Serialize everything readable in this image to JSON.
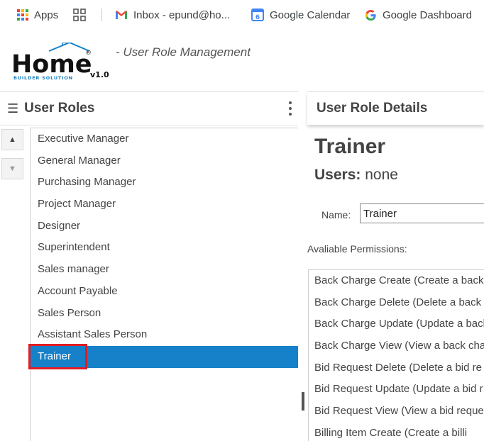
{
  "bookmarks": [
    {
      "label": "Apps",
      "icon": "apps-grid-icon"
    },
    {
      "label": "",
      "icon": "tab-groups-icon"
    },
    {
      "label": "Inbox - epund@ho...",
      "icon": "gmail-icon"
    },
    {
      "label": "Google Calendar",
      "icon": "google-calendar-icon"
    },
    {
      "label": "Google Dashboard",
      "icon": "google-g-icon"
    }
  ],
  "header": {
    "logo_main": "Home",
    "logo_sub": "BUILDER SOLUTION",
    "logo_version": "v1.0",
    "logo_reg": "®",
    "subtitle": "- User Role Management"
  },
  "left_panel": {
    "title": "User Roles",
    "roles": [
      "Executive Manager",
      "General Manager",
      "Purchasing Manager",
      "Project Manager",
      "Designer",
      "Superintendent",
      "Sales manager",
      "Account Payable",
      "Sales Person",
      "Assistant Sales Person",
      "Trainer"
    ],
    "selected_index": 10
  },
  "right_panel": {
    "title": "User Role Details",
    "role_name": "Trainer",
    "users_label": "Users:",
    "users_value": "none",
    "name_label": "Name:",
    "name_value": "Trainer",
    "permissions_label": "Avaliable Permissions:",
    "permissions": [
      "Back Charge Create (Create a back c",
      "Back Charge Delete (Delete a back s",
      "Back Charge Update (Update a back",
      "Back Charge View (View a back char",
      "Bid Request Delete (Delete a bid re",
      "Bid Request Update (Update a bid r",
      "Bid Request View (View a bid reque",
      "Billing Item Create (Create a billi"
    ]
  },
  "colors": {
    "selected_bg": "#1681c8",
    "highlight_border": "#e31b23",
    "logo_text": "#111111",
    "logo_sub": "#1681c8"
  }
}
